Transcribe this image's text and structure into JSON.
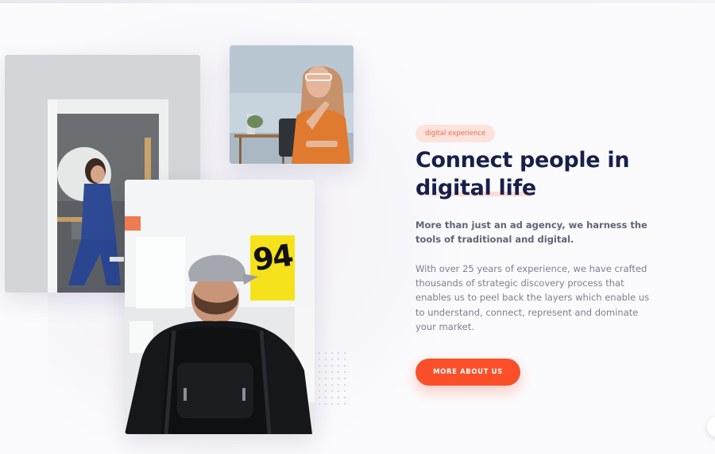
{
  "section": {
    "tag": "digital experience",
    "headline_lines": [
      "Connect people in",
      "digital life"
    ],
    "lead_lines": [
      "More than just an ad agency, we harness the",
      "tools of traditional and digital."
    ],
    "body_lines": [
      "With over 25 years of experience, we have crafted",
      "thousands of strategic discovery process that",
      "enables us to peel back the layers which enable us",
      "to understand, connect, represent and dominate",
      "your market."
    ],
    "cta_label": "MORE ABOUT US"
  },
  "photos": {
    "sticky_note_text": "94"
  },
  "colors": {
    "accent": "#fb4f2a",
    "heading": "#17204a",
    "tag_bg": "#fde3dc",
    "tag_text": "#f0694a"
  }
}
